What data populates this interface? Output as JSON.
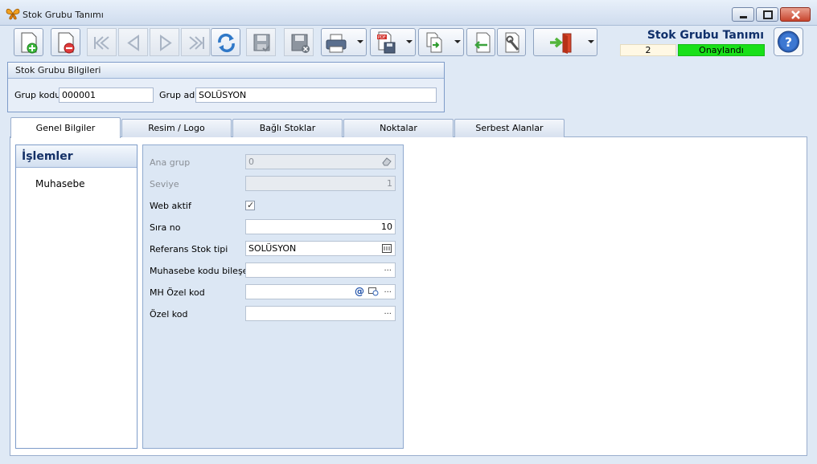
{
  "window": {
    "title": "Stok Grubu Tanımı"
  },
  "header": {
    "title": "Stok Grubu Tanımı",
    "record_no": "2",
    "status": "Onaylandı",
    "status_color": "#19e019"
  },
  "toolbar": {
    "buttons": [
      "new-record",
      "delete",
      "first",
      "previous",
      "next",
      "last",
      "refresh",
      "save",
      "save-close",
      "print",
      "pdf-export",
      "copy",
      "return",
      "settings",
      "exit"
    ]
  },
  "info_panel": {
    "title": "Stok Grubu Bilgileri",
    "group_code_label": "Grup kodu",
    "group_code_value": "000001",
    "group_name_label": "Grup adı",
    "group_name_value": "SOLÜSYON"
  },
  "tabs": [
    {
      "label": "Genel Bilgiler",
      "active": true
    },
    {
      "label": "Resim / Logo",
      "active": false
    },
    {
      "label": "Bağlı Stoklar",
      "active": false
    },
    {
      "label": "Noktalar",
      "active": false
    },
    {
      "label": "Serbest Alanlar",
      "active": false
    }
  ],
  "operations": {
    "title": "İşlemler",
    "items": [
      "Muhasebe"
    ]
  },
  "form": {
    "ana_grup": {
      "label": "Ana grup",
      "value": "0"
    },
    "seviye": {
      "label": "Seviye",
      "value": "1"
    },
    "web_aktif": {
      "label": "Web aktif",
      "checked": true,
      "check_mark": "✓"
    },
    "sira_no": {
      "label": "Sıra no",
      "value": "10"
    },
    "referans": {
      "label": "Referans Stok tipi",
      "value": "SOLÜSYON"
    },
    "muhasebe_kodu": {
      "label": "Muhasebe kodu bileşeni",
      "value": "",
      "ellipsis": "···"
    },
    "mh_ozel_kod": {
      "label": "MH Özel kod",
      "value": "",
      "at": "@",
      "ellipsis": "···"
    },
    "ozel_kod": {
      "label": "Özel kod",
      "value": "",
      "ellipsis": "···"
    }
  }
}
